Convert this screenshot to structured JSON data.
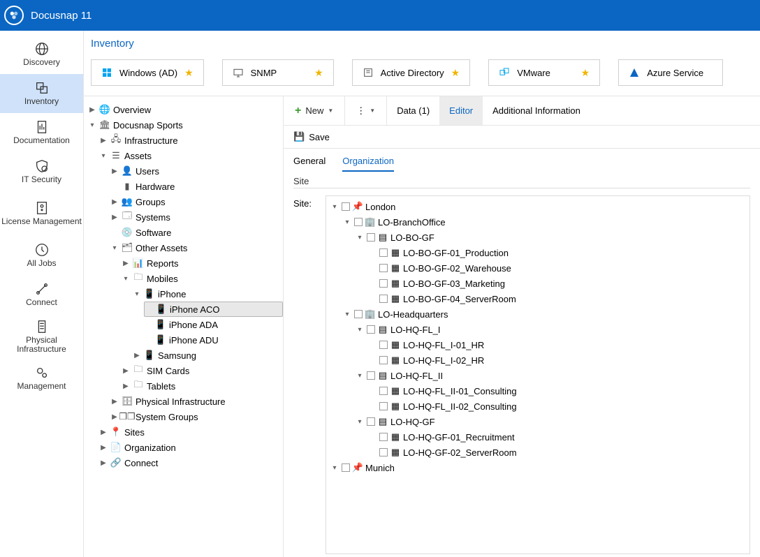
{
  "app_title": "Docusnap 11",
  "leftnav": [
    {
      "key": "discovery",
      "label": "Discovery"
    },
    {
      "key": "inventory",
      "label": "Inventory"
    },
    {
      "key": "documentation",
      "label": "Documentation"
    },
    {
      "key": "itsecurity",
      "label": "IT Security"
    },
    {
      "key": "license",
      "label": "License Management"
    },
    {
      "key": "alljobs",
      "label": "All Jobs"
    },
    {
      "key": "connect",
      "label": "Connect"
    },
    {
      "key": "physical",
      "label": "Physical Infrastructure"
    },
    {
      "key": "management",
      "label": "Management"
    }
  ],
  "header_title": "Inventory",
  "chips": [
    {
      "label": "Windows (AD)",
      "star": true,
      "icon": "windows",
      "color": "#00a4ef"
    },
    {
      "label": "SNMP",
      "star": true,
      "icon": "monitor",
      "color": "#555"
    },
    {
      "label": "Active Directory",
      "star": true,
      "icon": "ad",
      "color": "#555"
    },
    {
      "label": "VMware",
      "star": true,
      "icon": "vmware",
      "color": "#00a4ef"
    },
    {
      "label": "Azure Service",
      "star": false,
      "icon": "azure",
      "color": "#0b66c3"
    }
  ],
  "tree": {
    "overview": "Overview",
    "root": "Docusnap Sports",
    "infra": "Infrastructure",
    "assets": "Assets",
    "users": "Users",
    "hardware": "Hardware",
    "groups": "Groups",
    "systems": "Systems",
    "software": "Software",
    "other": "Other Assets",
    "reports": "Reports",
    "mobiles": "Mobiles",
    "iphone": "iPhone",
    "iphone_aco": "iPhone ACO",
    "iphone_ada": "iPhone ADA",
    "iphone_adu": "iPhone ADU",
    "samsung": "Samsung",
    "sim": "SIM Cards",
    "tablets": "Tablets",
    "physinfra": "Physical Infrastructure",
    "sysgroups": "System Groups",
    "sites": "Sites",
    "organization": "Organization",
    "connect": "Connect"
  },
  "toolbar": {
    "new_label": "New",
    "data_label": "Data (1)",
    "editor_label": "Editor",
    "addl_label": "Additional Information",
    "save_label": "Save"
  },
  "form": {
    "general_label": "General",
    "org_label": "Organization",
    "section": "Site",
    "field_label": "Site:"
  },
  "site_tree": {
    "london": "London",
    "branches": {
      "lobranch": "LO-BranchOffice",
      "lobogf": "LO-BO-GF",
      "lobo1": "LO-BO-GF-01_Production",
      "lobo2": "LO-BO-GF-02_Warehouse",
      "lobo3": "LO-BO-GF-03_Marketing",
      "lobo4": "LO-BO-GF-04_ServerRoom",
      "lohq": "LO-Headquarters",
      "lohqfl1": "LO-HQ-FL_I",
      "lohqfl1_1": "LO-HQ-FL_I-01_HR",
      "lohqfl1_2": "LO-HQ-FL_I-02_HR",
      "lohqfl2": "LO-HQ-FL_II",
      "lohqfl2_1": "LO-HQ-FL_II-01_Consulting",
      "lohqfl2_2": "LO-HQ-FL_II-02_Consulting",
      "lohqgf": "LO-HQ-GF",
      "lohqgf1": "LO-HQ-GF-01_Recruitment",
      "lohqgf2": "LO-HQ-GF-02_ServerRoom"
    },
    "munich": "Munich"
  }
}
